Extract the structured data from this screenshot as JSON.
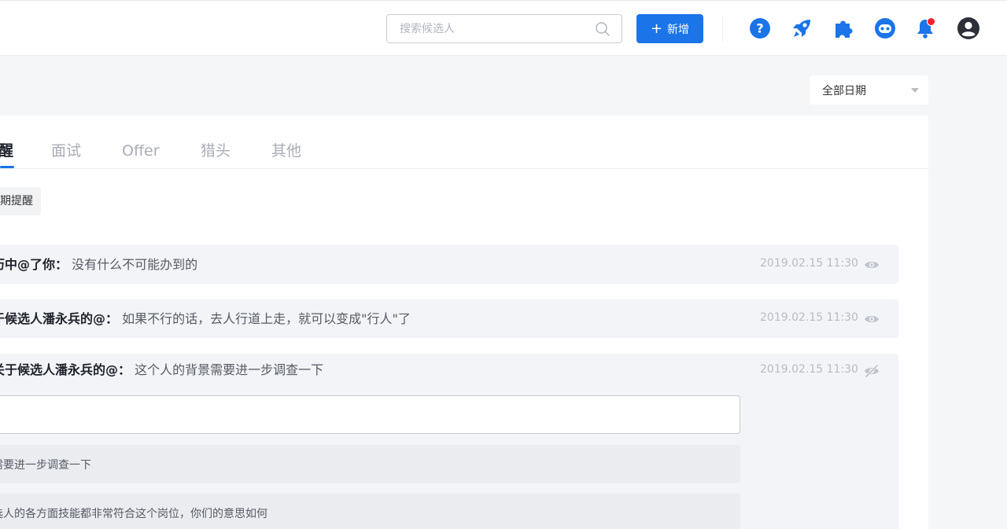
{
  "header": {
    "search_placeholder": "搜索候选人",
    "add_button_label": "新增",
    "icons": [
      "help-icon",
      "rocket-icon",
      "puzzle-icon",
      "robot-icon",
      "bell-icon",
      "user-icon"
    ],
    "accent_color": "#1b74e8",
    "notification_dot_color": "#f5222d"
  },
  "date_filter": {
    "selected": "全部日期"
  },
  "tabs": [
    {
      "label": "醒",
      "active": true
    },
    {
      "label": "面试",
      "active": false
    },
    {
      "label": "Offer",
      "active": false
    },
    {
      "label": "猎头",
      "active": false
    },
    {
      "label": "其他",
      "active": false
    }
  ],
  "filter_chip": "期提醒",
  "messages": [
    {
      "author": "历中@了你：",
      "text": "没有什么不可能办到的",
      "time": "2019.02.15 11:30",
      "icon": "eye-icon"
    },
    {
      "author": "于候选人潘永兵的@：",
      "text": "如果不行的话，去人行道上走，就可以变成\"行人\"了",
      "time": "2019.02.15 11:30",
      "icon": "eye-icon"
    },
    {
      "author": "关于候选人潘永兵的@：",
      "text": "这个人的背景需要进一步调查一下",
      "time": "2019.02.15 11:30",
      "icon": "eye-off-icon"
    }
  ],
  "replies": [
    "需要进一步调查一下",
    "选人的各方面技能都非常符合这个岗位，你们的意思如何"
  ]
}
